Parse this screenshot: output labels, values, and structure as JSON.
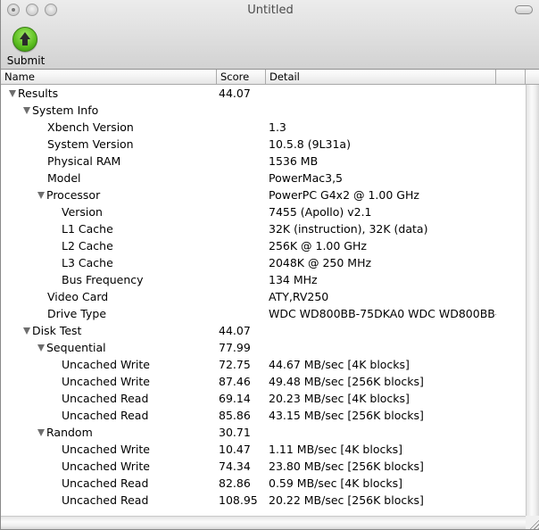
{
  "window": {
    "title": "Untitled"
  },
  "toolbar": {
    "submit_label": "Submit",
    "submit_icon": "green-up-arrow-icon"
  },
  "table": {
    "columns": [
      "Name",
      "Score",
      "Detail",
      ""
    ],
    "rows": [
      {
        "name": "Results",
        "score": "44.07",
        "detail": "",
        "level": 0,
        "expandable": true
      },
      {
        "name": "System Info",
        "score": "",
        "detail": "",
        "level": 1,
        "expandable": true
      },
      {
        "name": "Xbench Version",
        "score": "",
        "detail": "1.3",
        "level": 2,
        "expandable": false
      },
      {
        "name": "System Version",
        "score": "",
        "detail": "10.5.8 (9L31a)",
        "level": 2,
        "expandable": false
      },
      {
        "name": "Physical RAM",
        "score": "",
        "detail": "1536 MB",
        "level": 2,
        "expandable": false
      },
      {
        "name": "Model",
        "score": "",
        "detail": "PowerMac3,5",
        "level": 2,
        "expandable": false
      },
      {
        "name": "Processor",
        "score": "",
        "detail": "PowerPC G4x2 @ 1.00 GHz",
        "level": 2,
        "expandable": true
      },
      {
        "name": "Version",
        "score": "",
        "detail": "7455 (Apollo) v2.1",
        "level": 3,
        "expandable": false
      },
      {
        "name": "L1 Cache",
        "score": "",
        "detail": "32K (instruction), 32K (data)",
        "level": 3,
        "expandable": false
      },
      {
        "name": "L2 Cache",
        "score": "",
        "detail": "256K @ 1.00 GHz",
        "level": 3,
        "expandable": false
      },
      {
        "name": "L3 Cache",
        "score": "",
        "detail": "2048K @ 250 MHz",
        "level": 3,
        "expandable": false
      },
      {
        "name": "Bus Frequency",
        "score": "",
        "detail": "134 MHz",
        "level": 3,
        "expandable": false
      },
      {
        "name": "Video Card",
        "score": "",
        "detail": "ATY,RV250",
        "level": 2,
        "expandable": false
      },
      {
        "name": "Drive Type",
        "score": "",
        "detail": "WDC WD800BB-75DKA0 WDC WD800BB-",
        "level": 2,
        "expandable": false
      },
      {
        "name": "Disk Test",
        "score": "44.07",
        "detail": "",
        "level": 1,
        "expandable": true
      },
      {
        "name": "Sequential",
        "score": "77.99",
        "detail": "",
        "level": 2,
        "expandable": true
      },
      {
        "name": "Uncached Write",
        "score": "72.75",
        "detail": "44.67 MB/sec [4K blocks]",
        "level": 3,
        "expandable": false
      },
      {
        "name": "Uncached Write",
        "score": "87.46",
        "detail": "49.48 MB/sec [256K blocks]",
        "level": 3,
        "expandable": false
      },
      {
        "name": "Uncached Read",
        "score": "69.14",
        "detail": "20.23 MB/sec [4K blocks]",
        "level": 3,
        "expandable": false
      },
      {
        "name": "Uncached Read",
        "score": "85.86",
        "detail": "43.15 MB/sec [256K blocks]",
        "level": 3,
        "expandable": false
      },
      {
        "name": "Random",
        "score": "30.71",
        "detail": "",
        "level": 2,
        "expandable": true
      },
      {
        "name": "Uncached Write",
        "score": "10.47",
        "detail": "1.11 MB/sec [4K blocks]",
        "level": 3,
        "expandable": false
      },
      {
        "name": "Uncached Write",
        "score": "74.34",
        "detail": "23.80 MB/sec [256K blocks]",
        "level": 3,
        "expandable": false
      },
      {
        "name": "Uncached Read",
        "score": "82.86",
        "detail": "0.59 MB/sec [4K blocks]",
        "level": 3,
        "expandable": false
      },
      {
        "name": "Uncached Read",
        "score": "108.95",
        "detail": "20.22 MB/sec [256K blocks]",
        "level": 3,
        "expandable": false
      }
    ]
  }
}
